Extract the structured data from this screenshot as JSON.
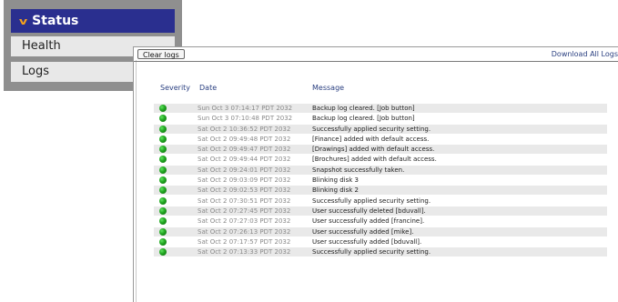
{
  "nav": {
    "status_label": "Status",
    "health_label": "Health",
    "logs_label": "Logs"
  },
  "panel": {
    "clear_logs_label": "Clear logs",
    "download_label": "Download All Logs",
    "columns": {
      "severity": "Severity",
      "date": "Date",
      "message": "Message"
    }
  },
  "colors": {
    "nav_active": "#2a2f8f",
    "chevron": "#f6a21c",
    "ok_status": "#1fa31f",
    "link": "#2a3f80"
  },
  "icons": {
    "status_chevron": "chevron-down-icon",
    "severity": "green-status-dot-icon"
  },
  "logs": [
    {
      "severity": "ok",
      "date": "Sun Oct 3 07:14:17 PDT 2032",
      "message": "Backup log cleared. [Job button]"
    },
    {
      "severity": "ok",
      "date": "Sun Oct 3 07:10:48 PDT 2032",
      "message": "Backup log cleared. [Job button]"
    },
    {
      "severity": "ok",
      "date": "Sat Oct 2 10:36:52 PDT 2032",
      "message": "Successfully applied security setting."
    },
    {
      "severity": "ok",
      "date": "Sat Oct 2 09:49:48 PDT 2032",
      "message": "[Finance] added with default access."
    },
    {
      "severity": "ok",
      "date": "Sat Oct 2 09:49:47 PDT 2032",
      "message": "[Drawings] added with default access."
    },
    {
      "severity": "ok",
      "date": "Sat Oct 2 09:49:44 PDT 2032",
      "message": "[Brochures] added with default access."
    },
    {
      "severity": "ok",
      "date": "Sat Oct 2 09:24:01 PDT 2032",
      "message": "Snapshot successfully taken."
    },
    {
      "severity": "ok",
      "date": "Sat Oct 2 09:03:09 PDT 2032",
      "message": "Blinking disk 3"
    },
    {
      "severity": "ok",
      "date": "Sat Oct 2 09:02:53 PDT 2032",
      "message": "Blinking disk 2"
    },
    {
      "severity": "ok",
      "date": "Sat Oct 2 07:30:51 PDT 2032",
      "message": "Successfully applied security setting."
    },
    {
      "severity": "ok",
      "date": "Sat Oct 2 07:27:45 PDT 2032",
      "message": "User successfully deleted [bduvall]."
    },
    {
      "severity": "ok",
      "date": "Sat Oct 2 07:27:03 PDT 2032",
      "message": "User successfully added [francine]."
    },
    {
      "severity": "ok",
      "date": "Sat Oct 2 07:26:13 PDT 2032",
      "message": "User successfully added [mike]."
    },
    {
      "severity": "ok",
      "date": "Sat Oct 2 07:17:57 PDT 2032",
      "message": "User successfully added [bduvall]."
    },
    {
      "severity": "ok",
      "date": "Sat Oct 2 07:13:33 PDT 2032",
      "message": "Successfully applied security setting."
    }
  ]
}
